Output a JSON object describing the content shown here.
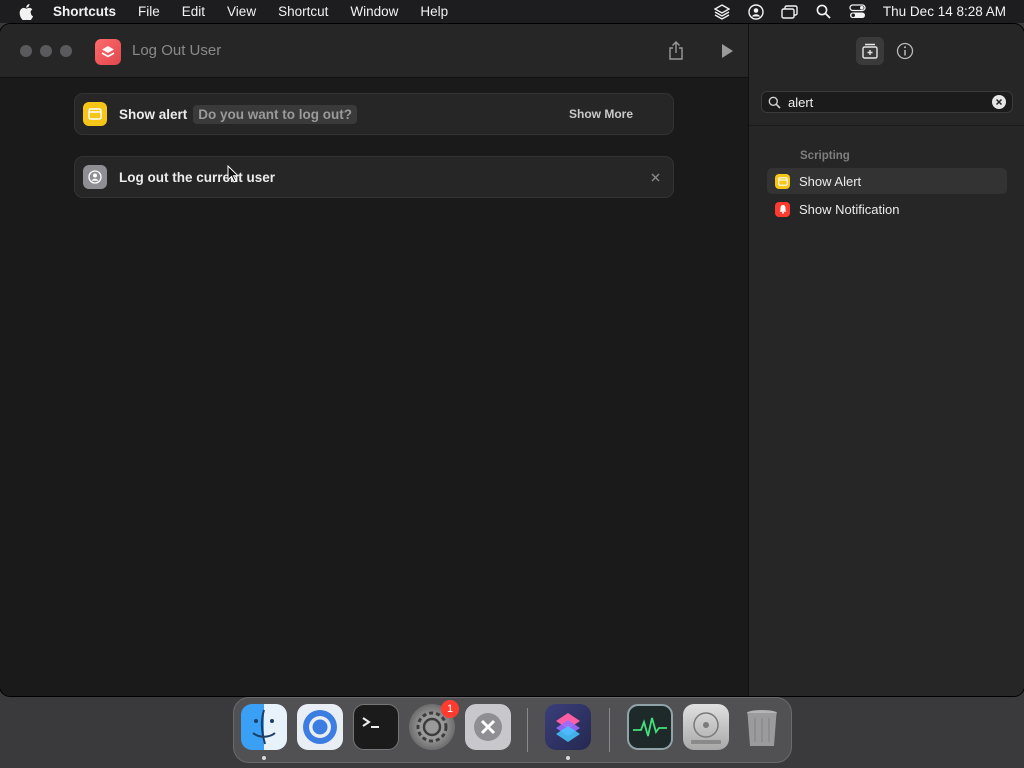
{
  "menubar": {
    "app_name": "Shortcuts",
    "menus": [
      "File",
      "Edit",
      "View",
      "Shortcut",
      "Window",
      "Help"
    ],
    "clock": "Thu Dec 14  8:28 AM",
    "status_icons": [
      "layers-icon",
      "user-circle-icon",
      "screen-mirror-icon",
      "search-icon",
      "control-center-icon"
    ]
  },
  "window": {
    "title": "Log Out User",
    "accent": "#e9545b"
  },
  "actions": [
    {
      "label": "Show alert",
      "param": "Do you want to log out?",
      "more": "Show More",
      "icon": "alert-window-icon",
      "color": "#f5c518"
    },
    {
      "label": "Log out the current user",
      "icon": "user-icon",
      "color": "#8e8e93"
    }
  ],
  "sidebar": {
    "search_value": "alert",
    "section": "Scripting",
    "items": [
      {
        "label": "Show Alert",
        "icon": "alert-window-icon",
        "color": "#f5c518"
      },
      {
        "label": "Show Notification",
        "icon": "notification-bell-icon",
        "color": "#ff3b30"
      }
    ]
  },
  "dock": {
    "apps": [
      "Finder",
      "Chromium",
      "Terminal",
      "System Settings",
      "Xcode Cleaner",
      "Shortcuts",
      "Activity Monitor",
      "Disk Utility",
      "Trash"
    ],
    "settings_badge": "1"
  }
}
